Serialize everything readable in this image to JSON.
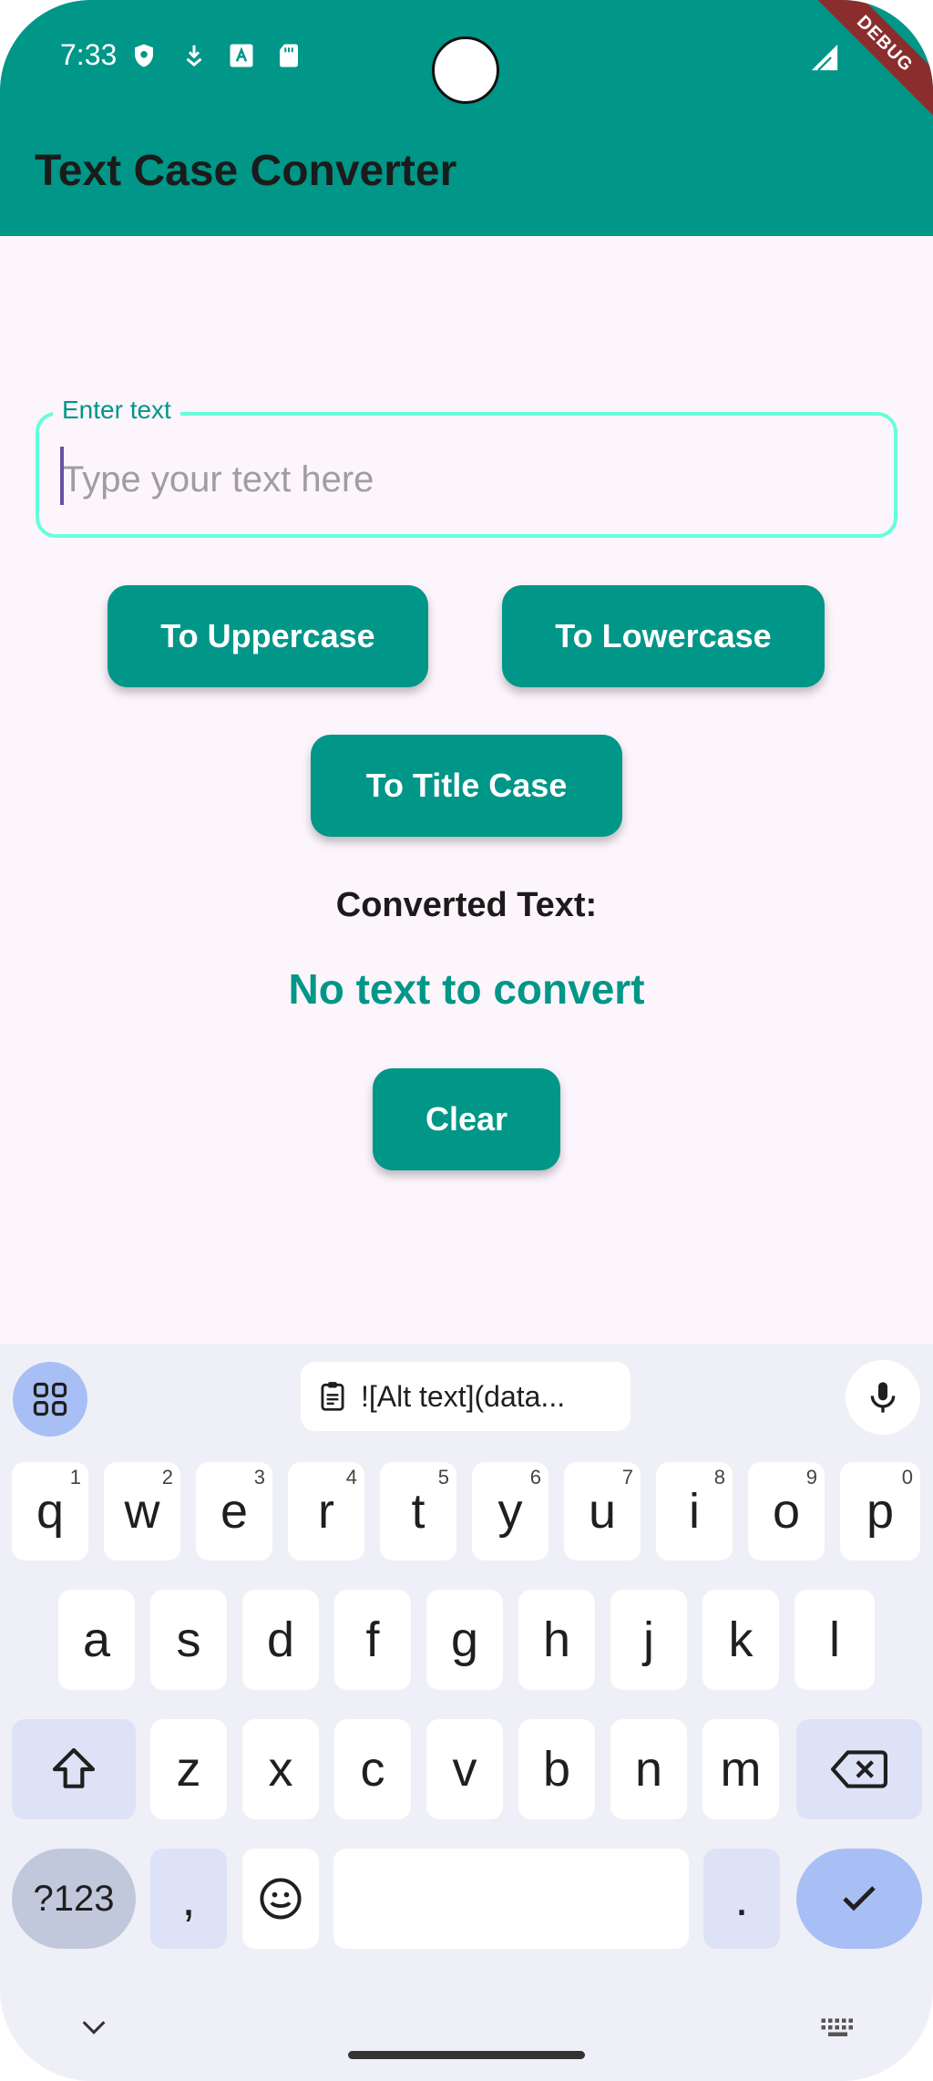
{
  "status_bar": {
    "time": "7:33"
  },
  "debug_banner": "DEBUG",
  "app_bar": {
    "title": "Text Case Converter"
  },
  "input": {
    "label": "Enter text",
    "placeholder": "Type your text here",
    "value": ""
  },
  "buttons": {
    "uppercase": "To Uppercase",
    "lowercase": "To Lowercase",
    "titlecase": "To Title Case",
    "clear": "Clear"
  },
  "result": {
    "label": "Converted Text:",
    "value": "No text to convert"
  },
  "keyboard": {
    "clipboard_suggestion": "![Alt text](data...",
    "row1": [
      {
        "key": "q",
        "hint": "1"
      },
      {
        "key": "w",
        "hint": "2"
      },
      {
        "key": "e",
        "hint": "3"
      },
      {
        "key": "r",
        "hint": "4"
      },
      {
        "key": "t",
        "hint": "5"
      },
      {
        "key": "y",
        "hint": "6"
      },
      {
        "key": "u",
        "hint": "7"
      },
      {
        "key": "i",
        "hint": "8"
      },
      {
        "key": "o",
        "hint": "9"
      },
      {
        "key": "p",
        "hint": "0"
      }
    ],
    "row2": [
      "a",
      "s",
      "d",
      "f",
      "g",
      "h",
      "j",
      "k",
      "l"
    ],
    "row3": [
      "z",
      "x",
      "c",
      "v",
      "b",
      "n",
      "m"
    ],
    "symbols_key": "?123",
    "comma_key": ",",
    "period_key": "."
  },
  "colors": {
    "primary": "#009688",
    "field_border": "#64ffda",
    "background": "#fdf5fc"
  }
}
